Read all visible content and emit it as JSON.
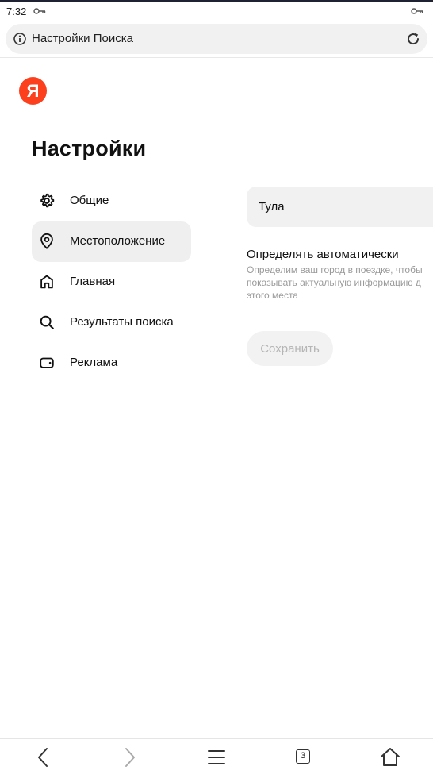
{
  "status_bar": {
    "time": "7:32"
  },
  "address_bar": {
    "title": "Настройки Поиска"
  },
  "logo": {
    "letter": "Я",
    "color": "#fc3f1d"
  },
  "page": {
    "title": "Настройки"
  },
  "sidebar": {
    "items": [
      {
        "label": "Общие",
        "icon": "gear-icon",
        "active": false
      },
      {
        "label": "Местоположение",
        "icon": "location-pin-icon",
        "active": true
      },
      {
        "label": "Главная",
        "icon": "home-icon",
        "active": false
      },
      {
        "label": "Результаты поиска",
        "icon": "search-icon",
        "active": false
      },
      {
        "label": "Реклама",
        "icon": "wallet-icon",
        "active": false
      }
    ]
  },
  "location": {
    "city_value": "Тула",
    "auto_detect_title": "Определять автоматически",
    "auto_detect_description_lines": [
      "Определим ваш город в поездке, чтобы",
      "показывать актуальную информацию д",
      "этого места"
    ],
    "save_label": "Сохранить"
  },
  "bottom_bar": {
    "tabs_count": "3"
  }
}
